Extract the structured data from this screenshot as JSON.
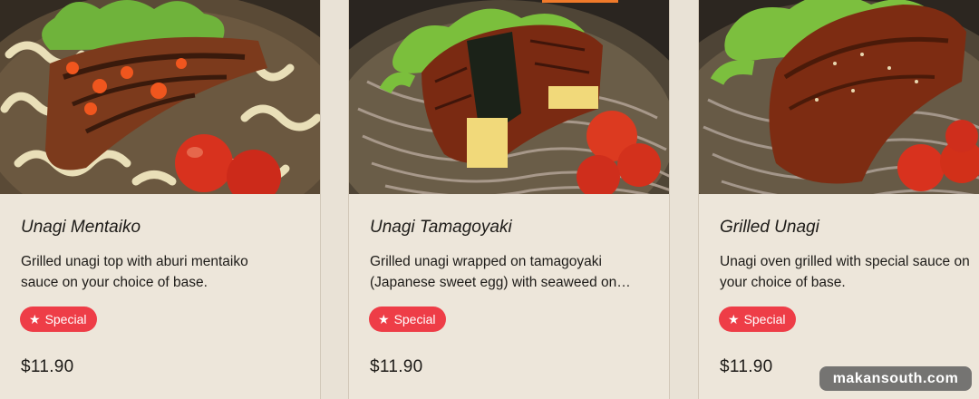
{
  "colors": {
    "page_bg": "#e9e2d6",
    "badge": "#ee3d47",
    "accent_bar": "#f07a2a"
  },
  "cards": [
    {
      "name": "Unagi Mentaiko",
      "desc_line1": "Grilled unagi top with aburi mentaiko",
      "desc_line2": "sauce on your choice of base.",
      "badge_icon": "star-icon",
      "badge_label": "Special",
      "price": "$11.90"
    },
    {
      "name": "Unagi Tamagoyaki",
      "desc_line1": "Grilled unagi wrapped on tamagoyaki",
      "desc_line2": "(Japanese sweet egg) with seaweed on…",
      "badge_icon": "star-icon",
      "badge_label": "Special",
      "price": "$11.90"
    },
    {
      "name": "Grilled Unagi",
      "desc_line1": "Unagi oven grilled with special sauce on",
      "desc_line2": "your choice of base.",
      "badge_icon": "star-icon",
      "badge_label": "Special",
      "price": "$11.90"
    }
  ],
  "watermark": "makansouth.com"
}
